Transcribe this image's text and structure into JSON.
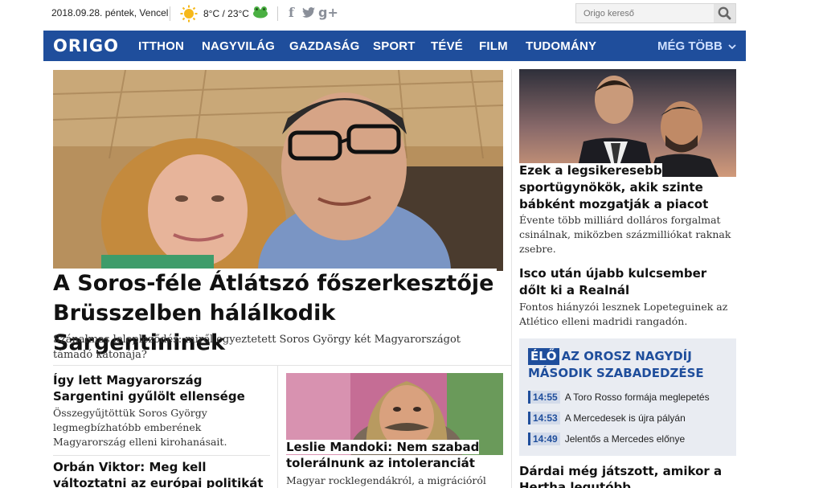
{
  "topbar": {
    "date": "2018.09.28. péntek, Vencel",
    "temperature": "8°C / 23°C",
    "social": {
      "facebook": "f",
      "twitter": "t",
      "google": "g+"
    },
    "search_placeholder": "Origo kereső"
  },
  "nav": {
    "logo": "ORIGO",
    "items": [
      "ITTHON",
      "NAGYVILÁG",
      "GAZDASÁG",
      "SPORT",
      "TÉVÉ",
      "FILM",
      "TUDOMÁNY"
    ],
    "more": "MÉG TÖBB"
  },
  "hero": {
    "title_line1": "A Soros-féle Átlátszó főszerkesztője",
    "title_line2": "Brüsszelben hálálkodik Sargentininek",
    "lead": "Szánalmas lelepleződés: miről egyeztetett Soros György két Magyarországot támadó katonája?"
  },
  "stories": {
    "left1": {
      "title": "Így lett Magyarország Sargentini gyűlölt ellensége",
      "lead": "Összegyűjtöttük Soros György legmegbízhatóbb emberének Magyarország elleni kirohanásait."
    },
    "left2": {
      "title": "Orbán Viktor: Meg kell változtatni az európai politikát"
    },
    "mandoki": {
      "title": "Leslie Mandoki: Nem szabad tolerálnunk az intoleranciát",
      "lead": "Magyar rocklegendákról, a migrációról"
    },
    "agents": {
      "title": "Ezek a legsikeresebb sportügynökök, akik szinte bábként mozgatják a piacot",
      "lead": "Évente több milliárd dolláros forgalmat csinálnak, miközben százmilliókat raknak zsebre."
    },
    "realnal": {
      "title": "Isco után újabb kulcsember dőlt ki a Realnál",
      "lead": "Fontos hiányzói lesznek Lopeteguinek az Atlético elleni madridi rangadón."
    },
    "dardai": {
      "title": "Dárdai még játszott, amikor a Hertha legutóbb"
    }
  },
  "live": {
    "badge": "ÉLŐ",
    "title": "AZ OROSZ NAGYDÍJ MÁSODIK SZABADEDZÉSE",
    "entries": [
      {
        "time": "14:55",
        "text": "A Toro Rosso formája meglepetés"
      },
      {
        "time": "14:53",
        "text": "A Mercedesek is újra pályán"
      },
      {
        "time": "14:49",
        "text": "Jelentős a Mercedes előnye"
      }
    ]
  },
  "colors": {
    "brand": "#1f4e9c",
    "live_bg": "#e9ecf2"
  }
}
